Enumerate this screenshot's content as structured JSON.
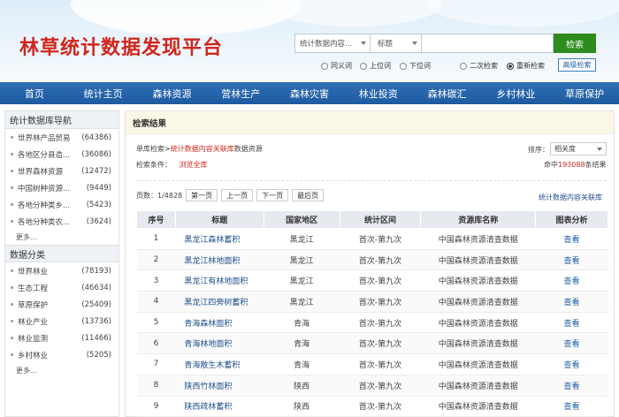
{
  "header": {
    "logo": "林草统计数据发现平台",
    "search_db": "统计数据内容...",
    "search_field": "标题",
    "search_value": "",
    "search_button": "检索",
    "options": {
      "synonym": "同义词",
      "broader": "上位词",
      "narrower": "下位词",
      "secondary": "二次检索",
      "research": "重新检索"
    },
    "advanced_button": "高级检索"
  },
  "nav": [
    "首页",
    "统计主页",
    "森林资源",
    "营林生产",
    "森林灾害",
    "林业投资",
    "森林碳汇",
    "乡村林业",
    "草原保护"
  ],
  "sidebar": {
    "section1": {
      "title": "统计数据库导航",
      "items": [
        {
          "label": "世界林产品贸易",
          "count": "(64386)"
        },
        {
          "label": "各地区分县造...",
          "count": "(36086)"
        },
        {
          "label": "世界森林资源",
          "count": "(12472)"
        },
        {
          "label": "中国树种资源...",
          "count": "(9449)"
        },
        {
          "label": "各地分种类乡...",
          "count": "(5423)"
        },
        {
          "label": "各地分种类农...",
          "count": "(3624)"
        }
      ],
      "more": "更多..."
    },
    "section2": {
      "title": "数据分类",
      "items": [
        {
          "label": "世界林业",
          "count": "(78193)"
        },
        {
          "label": "生态工程",
          "count": "(46634)"
        },
        {
          "label": "草原保护",
          "count": "(25409)"
        },
        {
          "label": "林业产业",
          "count": "(13736)"
        },
        {
          "label": "林业监测",
          "count": "(11466)"
        },
        {
          "label": "乡村林业",
          "count": "(5205)"
        }
      ],
      "more": "更多..."
    }
  },
  "main": {
    "title": "检索结果",
    "breadcrumb_prefix": "单库检索>",
    "breadcrumb_db": "统计数据内容关联库",
    "breadcrumb_suffix": "数据资源",
    "condition_label": "检索条件：",
    "condition_value": "浏览全库",
    "sort_label": "排序：",
    "sort_value": "相关度",
    "hits_prefix": "命中",
    "hits_count": "193088",
    "hits_suffix": "条结果",
    "pager": {
      "page_info": "页数：1/4828",
      "first": "第一页",
      "prev": "上一页",
      "next": "下一页",
      "last": "最后页"
    },
    "db_link": "统计数据内容关联库",
    "columns": [
      "序号",
      "标题",
      "国家地区",
      "统计区间",
      "资源库名称",
      "图表分析"
    ],
    "rows": [
      {
        "no": "1",
        "title": "黑龙江森林蓄积",
        "region": "黑龙江",
        "period": "首次-第九次",
        "db": "中国森林资源清查数据",
        "action": "查看"
      },
      {
        "no": "2",
        "title": "黑龙江林地面积",
        "region": "黑龙江",
        "period": "首次-第九次",
        "db": "中国森林资源清查数据",
        "action": "查看"
      },
      {
        "no": "3",
        "title": "黑龙江有林地面积",
        "region": "黑龙江",
        "period": "首次-第九次",
        "db": "中国森林资源清查数据",
        "action": "查看"
      },
      {
        "no": "4",
        "title": "黑龙江四旁树蓄积",
        "region": "黑龙江",
        "period": "首次-第九次",
        "db": "中国森林资源清查数据",
        "action": "查看"
      },
      {
        "no": "5",
        "title": "青海森林面积",
        "region": "青海",
        "period": "首次-第九次",
        "db": "中国森林资源清查数据",
        "action": "查看"
      },
      {
        "no": "6",
        "title": "青海林地面积",
        "region": "青海",
        "period": "首次-第九次",
        "db": "中国森林资源清查数据",
        "action": "查看"
      },
      {
        "no": "7",
        "title": "青海散生木蓄积",
        "region": "青海",
        "period": "首次-第九次",
        "db": "中国森林资源清查数据",
        "action": "查看"
      },
      {
        "no": "8",
        "title": "陕西竹林面积",
        "region": "陕西",
        "period": "首次-第九次",
        "db": "中国森林资源清查数据",
        "action": "查看"
      },
      {
        "no": "9",
        "title": "陕西疏林蓄积",
        "region": "陕西",
        "period": "首次-第九次",
        "db": "中国森林资源清查数据",
        "action": "查看"
      }
    ]
  }
}
